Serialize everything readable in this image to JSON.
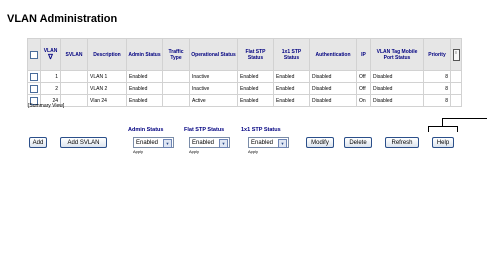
{
  "page": {
    "title": "VLAN Administration"
  },
  "table": {
    "headers": [
      "VLAN",
      "SVLAN",
      "Description",
      "Admin Status",
      "Traffic Type",
      "Operational Status",
      "Flat STP Status",
      "1x1 STP Status",
      "Authentication",
      "IP",
      "VLAN Tag Mobile Port Status",
      "Priority"
    ],
    "sort_icon": "∇",
    "rows": [
      {
        "vlan": "1",
        "svlan": "",
        "description": "VLAN 1",
        "admin": "Enabled",
        "traffic": "",
        "operational": "Inactive",
        "flat_stp": "Enabled",
        "stp_1x1": "Enabled",
        "auth": "Disabled",
        "ip": "Off",
        "mobile": "Disabled",
        "priority": "8"
      },
      {
        "vlan": "2",
        "svlan": "",
        "description": "VLAN 2",
        "admin": "Enabled",
        "traffic": "",
        "operational": "Inactive",
        "flat_stp": "Enabled",
        "stp_1x1": "Enabled",
        "auth": "Disabled",
        "ip": "Off",
        "mobile": "Disabled",
        "priority": "8"
      },
      {
        "vlan": "24",
        "svlan": "",
        "description": "Vlan 24",
        "admin": "Enabled",
        "traffic": "",
        "operational": "Active",
        "flat_stp": "Enabled",
        "stp_1x1": "Enabled",
        "auth": "Disabled",
        "ip": "On",
        "mobile": "Disabled",
        "priority": "8"
      }
    ]
  },
  "summary_view": "[Summary View]",
  "actions": {
    "add": "Add",
    "add_svlan": "Add SVLAN",
    "admin_status_label": "Admin Status",
    "admin_status_value": "Enabled",
    "flat_stp_label": "Flat STP Status",
    "flat_stp_value": "Enabled",
    "stp_1x1_label": "1x1 STP Status",
    "stp_1x1_value": "Enabled",
    "apply": "Apply",
    "modify": "Modify",
    "delete": "Delete",
    "refresh": "Refresh",
    "help": "Help"
  }
}
